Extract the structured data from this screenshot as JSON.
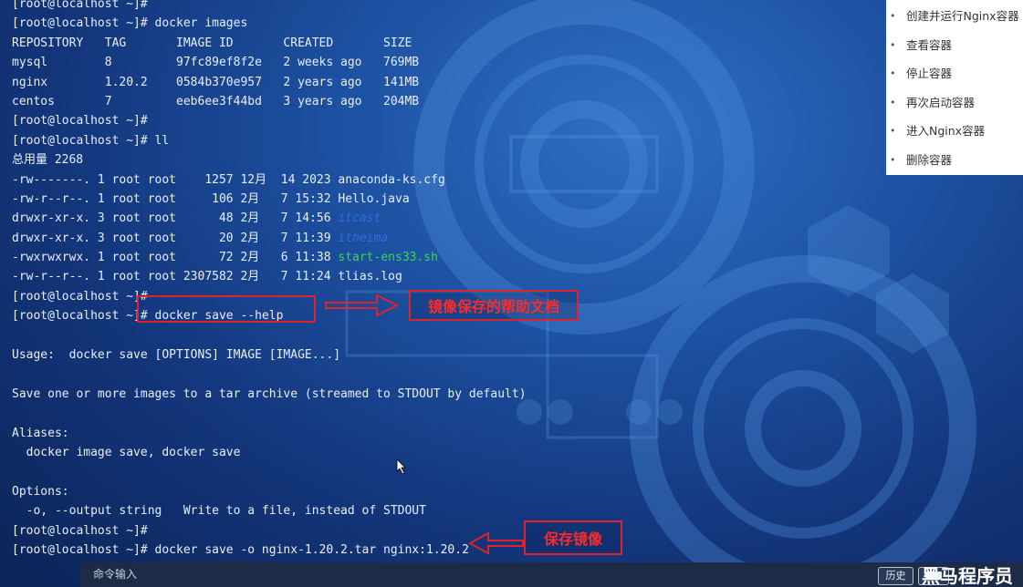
{
  "terminal": {
    "lines": [
      {
        "text": "[root@localhost ~]# "
      },
      {
        "text": "[root@localhost ~]# docker images"
      },
      {
        "text": "REPOSITORY   TAG       IMAGE ID       CREATED       SIZE"
      },
      {
        "text": "mysql        8         97fc89ef8f2e   2 weeks ago   769MB"
      },
      {
        "text": "nginx        1.20.2    0584b370e957   2 years ago   141MB"
      },
      {
        "text": "centos       7         eeb6ee3f44bd   3 years ago   204MB"
      },
      {
        "text": "[root@localhost ~]#"
      },
      {
        "text": "[root@localhost ~]# ll"
      },
      {
        "text": "总用量 2268"
      },
      {
        "text": "-rw-------. 1 root root    1257 12月  14 2023 anaconda-ks.cfg"
      },
      {
        "text": "-rw-r--r--. 1 root root     106 2月   7 15:32 Hello.java"
      },
      {
        "prefix": "drwxr-xr-x. 3 root root      48 2月   7 14:56 ",
        "name": "itcast",
        "kind": "dir"
      },
      {
        "prefix": "drwxr-xr-x. 3 root root      20 2月   7 11:39 ",
        "name": "itheima",
        "kind": "dir"
      },
      {
        "prefix": "-rwxrwxrwx. 1 root root      72 2月   6 11:38 ",
        "name": "start-ens33.sh",
        "kind": "exe"
      },
      {
        "text": "-rw-r--r--. 1 root root 2307582 2月   7 11:24 tlias.log"
      },
      {
        "text": "[root@localhost ~]#"
      },
      {
        "text": "[root@localhost ~]# docker save --help"
      },
      {
        "text": ""
      },
      {
        "text": "Usage:  docker save [OPTIONS] IMAGE [IMAGE...]"
      },
      {
        "text": ""
      },
      {
        "text": "Save one or more images to a tar archive (streamed to STDOUT by default)"
      },
      {
        "text": ""
      },
      {
        "text": "Aliases:"
      },
      {
        "text": "  docker image save, docker save"
      },
      {
        "text": ""
      },
      {
        "text": "Options:"
      },
      {
        "text": "  -o, --output string   Write to a file, instead of STDOUT"
      },
      {
        "text": "[root@localhost ~]#"
      },
      {
        "text": "[root@localhost ~]# docker save -o nginx-1.20.2.tar nginx:1.20.2"
      }
    ]
  },
  "annotations": {
    "help_label": "镜像保存的帮助文档",
    "save_label": "保存镜像"
  },
  "menu": {
    "items": [
      "创建并运行Nginx容器",
      "查看容器",
      "停止容器",
      "再次启动容器",
      "进入Nginx容器",
      "删除容器"
    ]
  },
  "bottombar": {
    "input_placeholder": "命令输入",
    "history_label": "历史",
    "logo_text": "黑马程序员"
  },
  "colors": {
    "annotation_red": "#e0222a",
    "dir_blue": "#2e6be6",
    "exe_green": "#3fd25a"
  }
}
